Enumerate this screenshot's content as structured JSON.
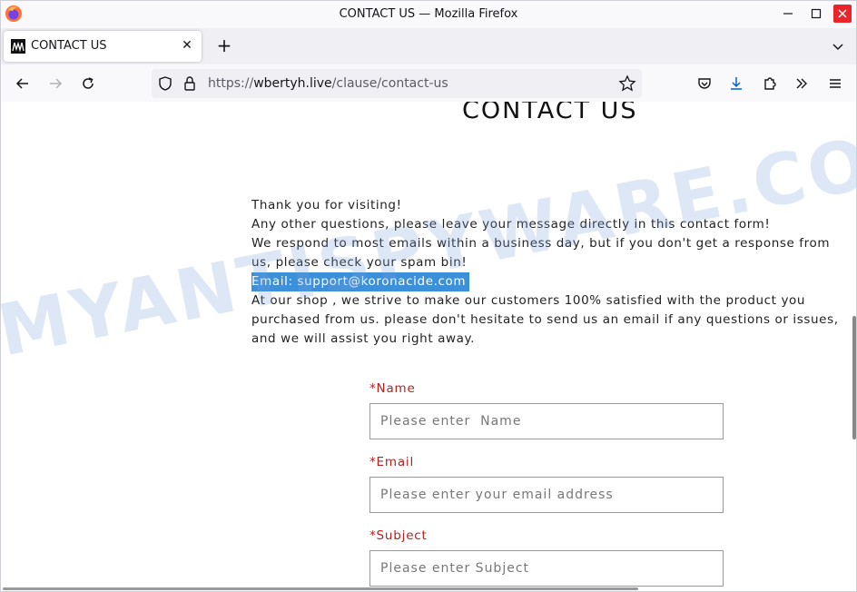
{
  "window": {
    "title": "CONTACT US — Mozilla Firefox",
    "minimize_icon": "minimize-icon",
    "maximize_icon": "maximize-icon",
    "close_icon": "close-icon"
  },
  "tabs": [
    {
      "label": "CONTACT US",
      "favicon": "site-favicon",
      "active": true
    }
  ],
  "navbar": {
    "url_prefix": "https://",
    "url_host": "wbertyh.live",
    "url_path": "/clause/contact-us"
  },
  "page": {
    "heading": "CONTACT US",
    "intro_lines": [
      "Thank you for visiting!",
      "Any other questions, please leave your message directly in this contact form!",
      "We respond to most emails within a business day, but if you don't get a response from us, please check your spam bin!",
      "Email: support@koronacide.com",
      "At our shop , we strive to make our customers 100% satisfied with the product you purchased from us. please don't hesitate to send us an email if any questions or issues, and we will assist you right away."
    ],
    "form": {
      "name_label": "*Name",
      "name_placeholder": "Please enter  Name",
      "email_label": "*Email",
      "email_placeholder": "Please enter your email address",
      "subject_label": "*Subject",
      "subject_placeholder": "Please enter Subject"
    }
  },
  "watermark": "MYANTISPYWARE.COM",
  "colors": {
    "highlight": "#3c8fd9",
    "required_label": "#b22222",
    "close_button": "#e8252b"
  }
}
